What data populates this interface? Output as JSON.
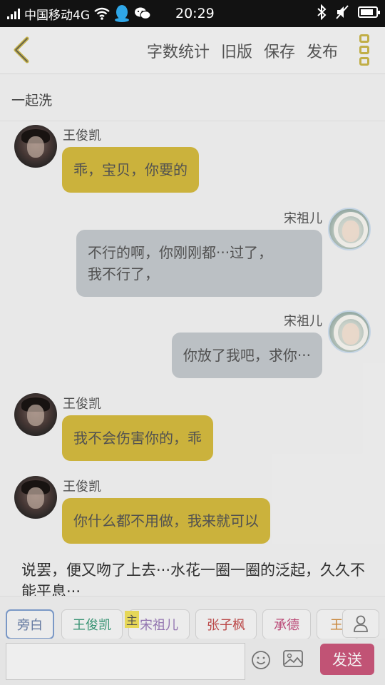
{
  "status_bar": {
    "carrier": "中国移动4G",
    "time": "20:29",
    "battery_fraction": 0.85
  },
  "toolbar": {
    "actions": [
      "字数统计",
      "旧版",
      "保存",
      "发布"
    ]
  },
  "chapter": {
    "title": "一起洗"
  },
  "messages": [
    {
      "speaker": "王俊凯",
      "side": "left",
      "text": "乖，宝贝，你要的"
    },
    {
      "speaker": "宋祖儿",
      "side": "right",
      "text": "不行的啊，你刚刚都···过了，\n我不行了，"
    },
    {
      "speaker": "宋祖儿",
      "side": "right",
      "text": "你放了我吧，求你···"
    },
    {
      "speaker": "王俊凯",
      "side": "left",
      "text": "我不会伤害你的，乖"
    },
    {
      "speaker": "王俊凯",
      "side": "left",
      "text": "你什么都不用做，我来就可以"
    }
  ],
  "narration": "说罢，便又吻了上去···水花一圈一圈的泛起，久久不能平息···",
  "character_tabs": [
    {
      "label": "旁白",
      "color": "#6a7fa8"
    },
    {
      "label": "王俊凯",
      "color": "#3a9a78"
    },
    {
      "label": "宋祖儿",
      "color": "#9a7ab8"
    },
    {
      "label": "张子枫",
      "color": "#c24a4a"
    },
    {
      "label": "承德",
      "color": "#c24a7a"
    },
    {
      "label": "王",
      "color": "#d08a3a"
    }
  ],
  "host_badge": "主",
  "input": {
    "value": "",
    "placeholder": ""
  },
  "send_label": "发送",
  "colors": {
    "male_bubble": "#d4ba3f",
    "female_bubble": "#c3c8cc",
    "send": "#c9577a",
    "accent_icon": "#c9b64a"
  }
}
